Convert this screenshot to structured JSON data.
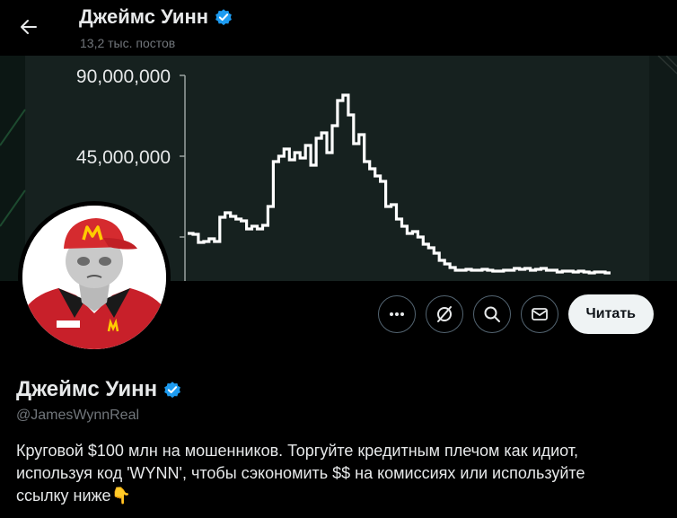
{
  "header": {
    "title": "Джеймс Уинн",
    "posts_count": "13,2 тыс. постов"
  },
  "banner": {
    "y_ticks": [
      "90,000,000",
      "45,000,000"
    ],
    "colors": {
      "background": "#15221f",
      "line": "#ffffff",
      "tick_text": "#e7e9ea"
    },
    "chart_data": {
      "type": "line",
      "title": "",
      "xlabel": "",
      "ylabel": "",
      "ylim": [
        0,
        90000000
      ],
      "yticks": [
        45000000,
        90000000
      ],
      "grid": false,
      "x": [
        0,
        1,
        2,
        3,
        4,
        5,
        6,
        7,
        8,
        9,
        10,
        11,
        12,
        13,
        14,
        15,
        16,
        17,
        18,
        19,
        20,
        21,
        22,
        23,
        24,
        25,
        26,
        27,
        28,
        29,
        30,
        31,
        32,
        33,
        34,
        35,
        36,
        37,
        38,
        39,
        40,
        41,
        42,
        43,
        44,
        45,
        46,
        47,
        48,
        49,
        50,
        51,
        52,
        53,
        54,
        55,
        56,
        57,
        58,
        59,
        60,
        61,
        62,
        63,
        64,
        65,
        66,
        67,
        68,
        69,
        70,
        71,
        72,
        73,
        74,
        75,
        76,
        77,
        78,
        79
      ],
      "values": [
        2000000,
        1500000,
        -3000000,
        -2500000,
        -1000000,
        -2500000,
        11000000,
        13500000,
        11500000,
        10000000,
        9000000,
        4500000,
        6000000,
        4500000,
        6500000,
        17000000,
        42000000,
        45000000,
        49000000,
        43000000,
        47000000,
        44000000,
        51000000,
        40000000,
        55000000,
        58000000,
        47000000,
        62000000,
        76000000,
        79000000,
        68000000,
        52000000,
        57000000,
        42000000,
        38000000,
        34000000,
        31000000,
        17000000,
        18000000,
        10000000,
        6000000,
        2000000,
        3000000,
        0,
        -4000000,
        -6000000,
        -9000000,
        -13000000,
        -15000000,
        -17000000,
        -18500000,
        -18500000,
        -18000000,
        -18500000,
        -18500000,
        -18000000,
        -18500000,
        -19000000,
        -19000000,
        -18500000,
        -18500000,
        -17500000,
        -18000000,
        -17500000,
        -18500000,
        -18000000,
        -17500000,
        -18500000,
        -18500000,
        -19500000,
        -19000000,
        -19000000,
        -19500000,
        -19000000,
        -19500000,
        -20000000,
        -19500000,
        -19500000,
        -20000000,
        -20000000
      ]
    }
  },
  "actions": {
    "more_icon": "more-dots-icon",
    "grok_icon": "grok-icon",
    "search_icon": "search-icon",
    "message_icon": "envelope-icon",
    "follow_label": "Читать"
  },
  "profile": {
    "name": "Джеймс Уинн",
    "handle": "@JamesWynnReal",
    "verified_color": "#1d9bf0",
    "bio_line1": "Круговой $100 млн на мошенников. Торгуйте кредитным плечом как идиот,",
    "bio_line2": "используя код 'WYNN', чтобы сэкономить $$ на комиссиях или используйте",
    "bio_line3": "ссылку ниже",
    "bio_emoji": "👇"
  }
}
